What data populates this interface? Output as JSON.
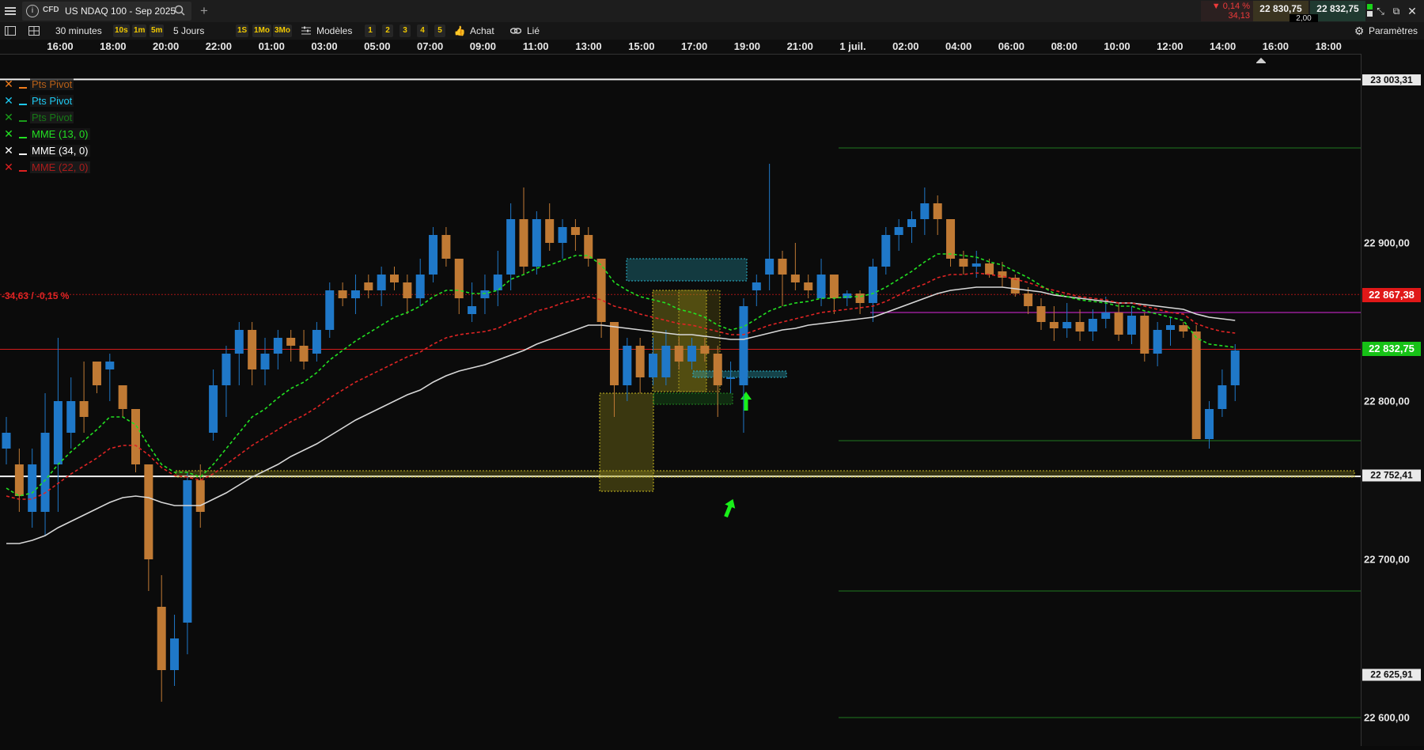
{
  "window": {
    "instrument_type": "CFD",
    "instrument_name": "US NDAQ 100 - Sep 2025",
    "add_tab": "+",
    "change_pct": "▼ 0,14 %",
    "change_abs": "34,13",
    "bid": "22 830,75",
    "ask": "22 832,75",
    "spread": "2,00"
  },
  "toolbar": {
    "timeframe": "30 minutes",
    "intervals": [
      "10s",
      "1m",
      "5m"
    ],
    "period": "5 Jours",
    "ranges": [
      "1S",
      "1Mo",
      "3Mo"
    ],
    "models_label": "Modèles",
    "slots": [
      "1",
      "2",
      "3",
      "4",
      "5"
    ],
    "buy_label": "Achat",
    "link_label": "Lié",
    "settings_label": "Paramètres"
  },
  "time_axis": {
    "ticks": [
      "16:00",
      "18:00",
      "20:00",
      "22:00",
      "01:00",
      "03:00",
      "05:00",
      "07:00",
      "09:00",
      "11:00",
      "13:00",
      "15:00",
      "17:00",
      "19:00",
      "21:00",
      "1 juil.",
      "02:00",
      "04:00",
      "06:00",
      "08:00",
      "10:00",
      "12:00",
      "14:00",
      "16:00",
      "18:00"
    ]
  },
  "legend": [
    {
      "label": "Pts Pivot",
      "color": "#f07c1c",
      "dim": true
    },
    {
      "label": "Pts Pivot",
      "color": "#1ec8f0",
      "dim": false
    },
    {
      "label": "Pts Pivot",
      "color": "#1a9e1a",
      "dim": true
    },
    {
      "label": "MME (13, 0)",
      "color": "#22e022",
      "dim": false
    },
    {
      "label": "MME (34, 0)",
      "color": "#ffffff",
      "dim": false
    },
    {
      "label": "MME (22, 0)",
      "color": "#e02020",
      "dim": true
    }
  ],
  "price_axis": {
    "labels": [
      "22 900,00",
      "22 800,00",
      "22 700,00",
      "22 600,00"
    ],
    "level_top": "23 003,31",
    "prev_close": "22 867,38",
    "current": "22 832,75",
    "level_support": "22 752,41",
    "level_low": "22 625,91",
    "change_label": "-34,63 / -0,15 %"
  },
  "chart_data": {
    "type": "candlestick",
    "interval": "30 minutes",
    "candles": [
      [
        22770,
        22790,
        22760,
        22780
      ],
      [
        22760,
        22770,
        22730,
        22740
      ],
      [
        22730,
        22770,
        22720,
        22760
      ],
      [
        22730,
        22805,
        22715,
        22780
      ],
      [
        22760,
        22840,
        22730,
        22800
      ],
      [
        22780,
        22815,
        22770,
        22800
      ],
      [
        22800,
        22825,
        22780,
        22790
      ],
      [
        22825,
        22820,
        22805,
        22810
      ],
      [
        22820,
        22830,
        22800,
        22825
      ],
      [
        22810,
        22800,
        22790,
        22795
      ],
      [
        22795,
        22795,
        22755,
        22760
      ],
      [
        22760,
        22740,
        22680,
        22700
      ],
      [
        22670,
        22690,
        22610,
        22630
      ],
      [
        22630,
        22665,
        22620,
        22650
      ],
      [
        22660,
        22755,
        22640,
        22750
      ],
      [
        22750,
        22760,
        22720,
        22730
      ],
      [
        22780,
        22820,
        22775,
        22810
      ],
      [
        22810,
        22835,
        22790,
        22830
      ],
      [
        22830,
        22850,
        22810,
        22845
      ],
      [
        22845,
        22850,
        22810,
        22820
      ],
      [
        22820,
        22840,
        22810,
        22830
      ],
      [
        22830,
        22845,
        22820,
        22840
      ],
      [
        22840,
        22845,
        22825,
        22835
      ],
      [
        22835,
        22845,
        22820,
        22825
      ],
      [
        22830,
        22850,
        22825,
        22845
      ],
      [
        22845,
        22875,
        22840,
        22870
      ],
      [
        22870,
        22875,
        22860,
        22865
      ],
      [
        22865,
        22880,
        22855,
        22870
      ],
      [
        22875,
        22880,
        22865,
        22870
      ],
      [
        22870,
        22885,
        22860,
        22880
      ],
      [
        22880,
        22885,
        22870,
        22875
      ],
      [
        22875,
        22880,
        22855,
        22865
      ],
      [
        22865,
        22890,
        22860,
        22880
      ],
      [
        22880,
        22910,
        22875,
        22905
      ],
      [
        22905,
        22910,
        22885,
        22890
      ],
      [
        22890,
        22890,
        22855,
        22865
      ],
      [
        22855,
        22875,
        22850,
        22860
      ],
      [
        22865,
        22880,
        22855,
        22870
      ],
      [
        22870,
        22895,
        22860,
        22880
      ],
      [
        22880,
        22925,
        22870,
        22915
      ],
      [
        22915,
        22935,
        22880,
        22885
      ],
      [
        22885,
        22920,
        22880,
        22915
      ],
      [
        22915,
        22925,
        22895,
        22900
      ],
      [
        22900,
        22915,
        22890,
        22910
      ],
      [
        22910,
        22915,
        22895,
        22905
      ],
      [
        22905,
        22910,
        22885,
        22890
      ],
      [
        22890,
        22880,
        22840,
        22850
      ],
      [
        22850,
        22850,
        22790,
        22810
      ],
      [
        22810,
        22840,
        22800,
        22835
      ],
      [
        22835,
        22840,
        22805,
        22815
      ],
      [
        22815,
        22840,
        22810,
        22830
      ],
      [
        22815,
        22845,
        22810,
        22835
      ],
      [
        22835,
        22840,
        22820,
        22825
      ],
      [
        22825,
        22840,
        22820,
        22835
      ],
      [
        22835,
        22840,
        22825,
        22830
      ],
      [
        22830,
        22835,
        22790,
        22810
      ],
      [
        22815,
        22825,
        22805,
        22815
      ],
      [
        22810,
        22865,
        22780,
        22860
      ],
      [
        22870,
        22880,
        22860,
        22875
      ],
      [
        22880,
        22950,
        22870,
        22890
      ],
      [
        22890,
        22895,
        22860,
        22880
      ],
      [
        22880,
        22900,
        22870,
        22875
      ],
      [
        22875,
        22880,
        22865,
        22870
      ],
      [
        22865,
        22890,
        22860,
        22880
      ],
      [
        22880,
        22880,
        22855,
        22865
      ],
      [
        22865,
        22870,
        22860,
        22868
      ],
      [
        22868,
        22870,
        22855,
        22862
      ],
      [
        22862,
        22890,
        22850,
        22885
      ],
      [
        22885,
        22910,
        22880,
        22905
      ],
      [
        22905,
        22915,
        22895,
        22910
      ],
      [
        22910,
        22920,
        22900,
        22915
      ],
      [
        22915,
        22935,
        22905,
        22925
      ],
      [
        22925,
        22930,
        22905,
        22915
      ],
      [
        22915,
        22915,
        22885,
        22890
      ],
      [
        22890,
        22895,
        22880,
        22885
      ],
      [
        22885,
        22895,
        22878,
        22887
      ],
      [
        22887,
        22890,
        22878,
        22880
      ],
      [
        22882,
        22888,
        22872,
        22878
      ],
      [
        22878,
        22880,
        22866,
        22868
      ],
      [
        22868,
        22872,
        22855,
        22860
      ],
      [
        22860,
        22865,
        22845,
        22850
      ],
      [
        22850,
        22860,
        22838,
        22846
      ],
      [
        22846,
        22862,
        22840,
        22850
      ],
      [
        22850,
        22858,
        22838,
        22844
      ],
      [
        22844,
        22858,
        22838,
        22852
      ],
      [
        22852,
        22866,
        22846,
        22856
      ],
      [
        22856,
        22862,
        22838,
        22842
      ],
      [
        22842,
        22860,
        22836,
        22854
      ],
      [
        22854,
        22856,
        22825,
        22830
      ],
      [
        22830,
        22850,
        22822,
        22845
      ],
      [
        22845,
        22853,
        22835,
        22848
      ],
      [
        22848,
        22850,
        22840,
        22844
      ],
      [
        22844,
        22848,
        22795,
        22776
      ],
      [
        22776,
        22800,
        22770,
        22795
      ],
      [
        22795,
        22820,
        22790,
        22810
      ],
      [
        22810,
        22836,
        22800,
        22832
      ]
    ],
    "ema13": [
      22745,
      22740,
      22742,
      22750,
      22760,
      22768,
      22775,
      22782,
      22790,
      22790,
      22785,
      22772,
      22760,
      22755,
      22755,
      22752,
      22760,
      22770,
      22780,
      22790,
      22795,
      22802,
      22808,
      22812,
      22818,
      22826,
      22832,
      22838,
      22843,
      22848,
      22853,
      22856,
      22860,
      22866,
      22870,
      22870,
      22868,
      22868,
      22870,
      22877,
      22880,
      22884,
      22886,
      22889,
      22892,
      22892,
      22886,
      22875,
      22870,
      22866,
      22864,
      22862,
      22858,
      22856,
      22853,
      22848,
      22845,
      22847,
      22852,
      22857,
      22860,
      22862,
      22863,
      22865,
      22865,
      22866,
      22866,
      22868,
      22872,
      22877,
      22882,
      22888,
      22893,
      22893,
      22892,
      22891,
      22888,
      22886,
      22882,
      22878,
      22873,
      22868,
      22866,
      22864,
      22863,
      22862,
      22860,
      22860,
      22857,
      22855,
      22853,
      22851,
      22840,
      22836,
      22835,
      22834
    ],
    "ema22": [
      22740,
      22738,
      22738,
      22742,
      22748,
      22754,
      22759,
      22764,
      22770,
      22772,
      22772,
      22766,
      22758,
      22753,
      22752,
      22750,
      22754,
      22760,
      22766,
      22772,
      22777,
      22782,
      22787,
      22791,
      22796,
      22802,
      22807,
      22812,
      22816,
      22820,
      22824,
      22828,
      22831,
      22836,
      22840,
      22842,
      22843,
      22844,
      22846,
      22850,
      22853,
      22857,
      22859,
      22862,
      22864,
      22866,
      22864,
      22860,
      22858,
      22855,
      22853,
      22851,
      22849,
      22848,
      22846,
      22844,
      22842,
      22842,
      22845,
      22848,
      22850,
      22852,
      22854,
      22856,
      22857,
      22858,
      22859,
      22860,
      22863,
      22867,
      22871,
      22874,
      22878,
      22880,
      22880,
      22881,
      22880,
      22879,
      22877,
      22875,
      22872,
      22870,
      22868,
      22866,
      22865,
      22864,
      22862,
      22862,
      22860,
      22858,
      22856,
      22855,
      22849,
      22846,
      22844,
      22843
    ],
    "ema34": [
      22710,
      22710,
      22712,
      22715,
      22720,
      22724,
      22728,
      22732,
      22736,
      22739,
      22740,
      22739,
      22736,
      22734,
      22734,
      22734,
      22738,
      22742,
      22747,
      22752,
      22756,
      22760,
      22765,
      22769,
      22773,
      22778,
      22783,
      22788,
      22792,
      22796,
      22800,
      22804,
      22807,
      22812,
      22816,
      22819,
      22821,
      22823,
      22826,
      22829,
      22832,
      22836,
      22839,
      22842,
      22845,
      22848,
      22848,
      22847,
      22846,
      22845,
      22844,
      22843,
      22842,
      22842,
      22841,
      22840,
      22839,
      22839,
      22841,
      22843,
      22845,
      22846,
      22848,
      22849,
      22850,
      22851,
      22852,
      22853,
      22856,
      22859,
      22862,
      22865,
      22868,
      22870,
      22871,
      22872,
      22872,
      22872,
      22871,
      22870,
      22869,
      22867,
      22866,
      22865,
      22864,
      22863,
      22862,
      22862,
      22861,
      22860,
      22859,
      22858,
      22855,
      22853,
      22852,
      22851
    ],
    "horizontal_levels": [
      23003.31,
      22867.38,
      22832.75,
      22752.41,
      22625.91
    ]
  }
}
